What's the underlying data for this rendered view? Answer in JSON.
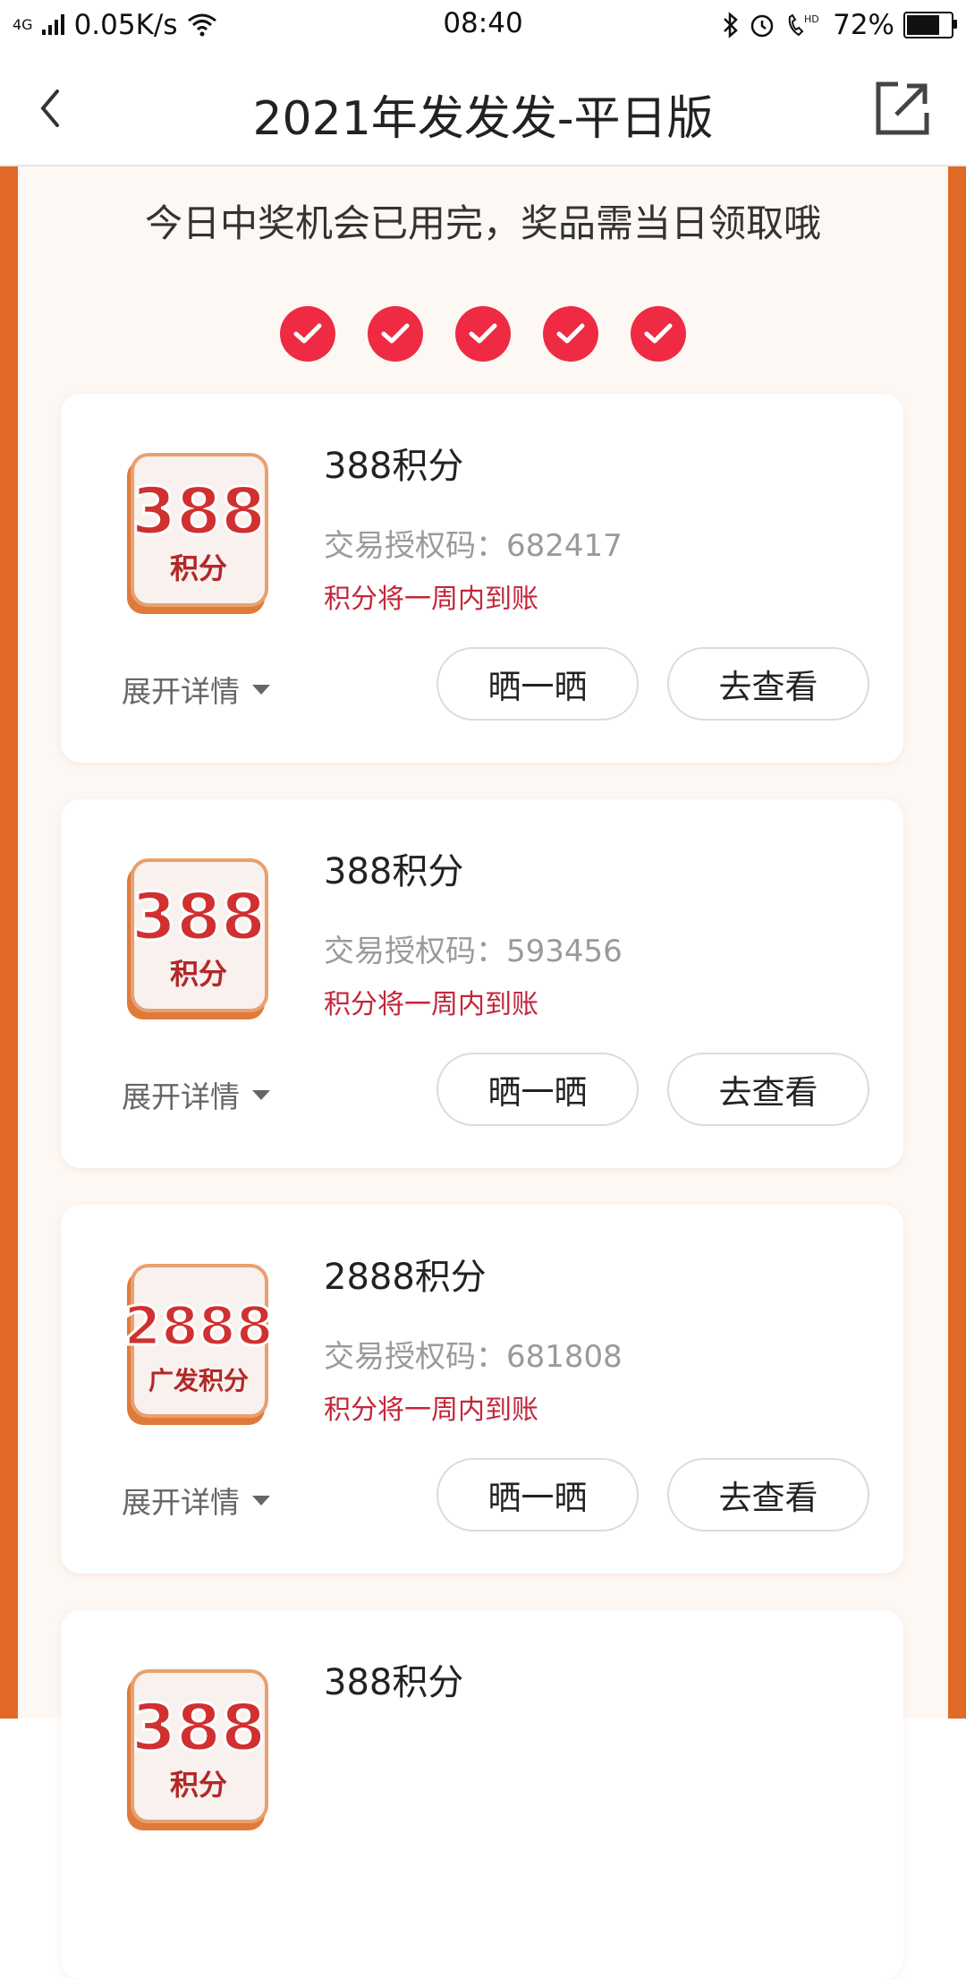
{
  "status_bar": {
    "network": "4G",
    "speed": "0.05K/s",
    "time": "08:40",
    "battery": "72%",
    "battery_level": 0.72
  },
  "nav": {
    "title": "2021年发发发-平日版",
    "back_icon": "chevron-left-icon",
    "share_icon": "external-link-icon"
  },
  "notice": "今日中奖机会已用完，奖品需当日领取哦",
  "checks_count": 5,
  "colors": {
    "accent_red": "#ee2b43",
    "frame_orange": "#e06a25",
    "arrive_red": "#c5253a"
  },
  "cards": [
    {
      "prize_name": "388积分",
      "badge_number": "388",
      "badge_label": "积分",
      "auth_code": "交易授权码：682417",
      "arrival_note": "积分将一周内到账",
      "expand_label": "展开详情",
      "share_label": "晒一晒",
      "view_label": "去查看"
    },
    {
      "prize_name": "388积分",
      "badge_number": "388",
      "badge_label": "积分",
      "auth_code": "交易授权码：593456",
      "arrival_note": "积分将一周内到账",
      "expand_label": "展开详情",
      "share_label": "晒一晒",
      "view_label": "去查看"
    },
    {
      "prize_name": "2888积分",
      "badge_number": "2888",
      "badge_label": "广发积分",
      "auth_code": "交易授权码：681808",
      "arrival_note": "积分将一周内到账",
      "expand_label": "展开详情",
      "share_label": "晒一晒",
      "view_label": "去查看"
    },
    {
      "prize_name": "388积分",
      "badge_number": "388",
      "badge_label": "积分"
    }
  ]
}
